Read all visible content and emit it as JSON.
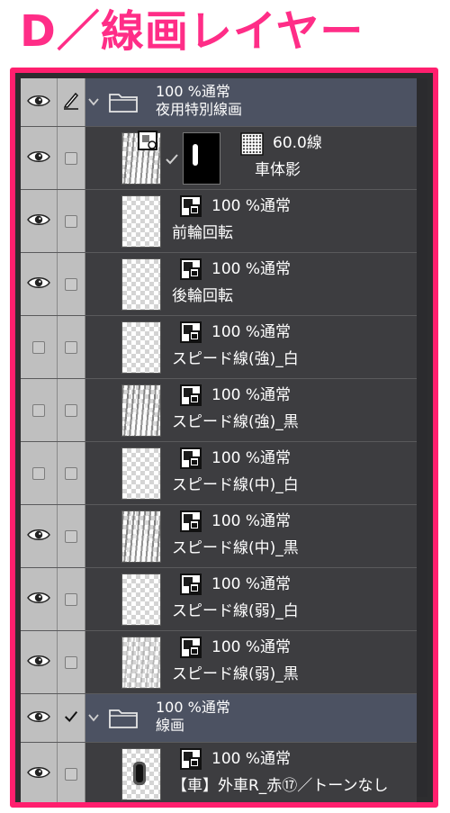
{
  "title": "D／線画レイヤー",
  "layers": [
    {
      "kind": "folder",
      "line1": "100 %通常",
      "line2": "夜用特別線画",
      "visible": true,
      "edit": "pen"
    },
    {
      "kind": "tone",
      "name": "車体影",
      "density": "60.0線",
      "visible": true
    },
    {
      "kind": "raster",
      "mode": "100 %通常",
      "name": "前輪回転",
      "visible": true,
      "thumb": "blank"
    },
    {
      "kind": "raster",
      "mode": "100 %通常",
      "name": "後輪回転",
      "visible": true,
      "thumb": "blank"
    },
    {
      "kind": "raster",
      "mode": "100 %通常",
      "name": "スピード線(強)_白",
      "visible": false,
      "thumb": "blank"
    },
    {
      "kind": "raster",
      "mode": "100 %通常",
      "name": "スピード線(強)_黒",
      "visible": false,
      "thumb": "speed"
    },
    {
      "kind": "raster",
      "mode": "100 %通常",
      "name": "スピード線(中)_白",
      "visible": false,
      "thumb": "blank"
    },
    {
      "kind": "raster",
      "mode": "100 %通常",
      "name": "スピード線(中)_黒",
      "visible": true,
      "thumb": "speed"
    },
    {
      "kind": "raster",
      "mode": "100 %通常",
      "name": "スピード線(弱)_白",
      "visible": true,
      "thumb": "blank"
    },
    {
      "kind": "raster",
      "mode": "100 %通常",
      "name": "スピード線(弱)_黒",
      "visible": true,
      "thumb": "faint"
    },
    {
      "kind": "folder",
      "line1": "100 %通常",
      "line2": "線画",
      "visible": true,
      "edit": "check"
    },
    {
      "kind": "raster",
      "mode": "100 %通常",
      "name": "【車】外車R_赤⑰／トーンなし",
      "visible": true,
      "thumb": "car"
    }
  ],
  "colors": {
    "accent": "#ff1f6e",
    "title": "#ff2d87",
    "panel": "#3d3d40",
    "folder_row": "#4c5262",
    "column": "#bfbfbf"
  }
}
